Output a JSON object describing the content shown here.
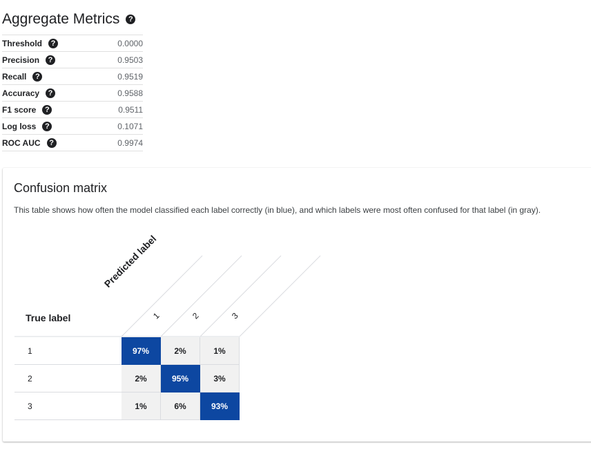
{
  "metrics": {
    "title": "Aggregate Metrics",
    "help_icon": "question-circle-icon",
    "rows": [
      {
        "name": "Threshold",
        "value": "0.0000"
      },
      {
        "name": "Precision",
        "value": "0.9503"
      },
      {
        "name": "Recall",
        "value": "0.9519"
      },
      {
        "name": "Accuracy",
        "value": "0.9588"
      },
      {
        "name": "F1 score",
        "value": "0.9511"
      },
      {
        "name": "Log loss",
        "value": "0.1071"
      },
      {
        "name": "ROC AUC",
        "value": "0.9974"
      }
    ]
  },
  "confusion": {
    "title": "Confusion matrix",
    "description": "This table shows how often the model classified each label correctly (in blue), and which labels were most often confused for that label (in gray).",
    "true_label_header": "True label",
    "predicted_label_header": "Predicted label",
    "labels": [
      "1",
      "2",
      "3"
    ],
    "cells": [
      [
        "97%",
        "2%",
        "1%"
      ],
      [
        "2%",
        "95%",
        "3%"
      ],
      [
        "1%",
        "6%",
        "93%"
      ]
    ],
    "colors": {
      "diagonal": "#0d47a1",
      "off_diagonal": "#f1f1f1"
    }
  }
}
